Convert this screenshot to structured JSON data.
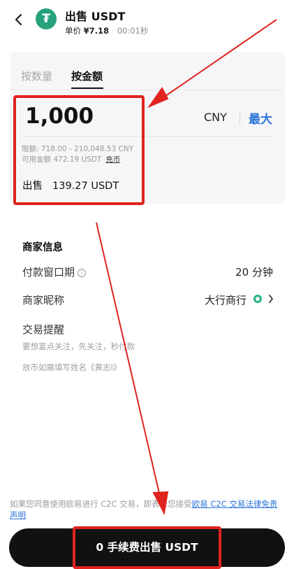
{
  "header": {
    "title": "出售 USDT",
    "unit_price_label": "单价",
    "unit_price": "¥7.18",
    "timer": "00:01秒",
    "coin_symbol": "₮"
  },
  "tabs": {
    "by_quantity": "按数量",
    "by_amount": "按金额"
  },
  "amount": {
    "value": "1,000",
    "currency": "CNY",
    "max_label": "最大",
    "limit": "限额: 718.00 - 210,048.53 CNY",
    "available": "可用金额 472.19 USDT",
    "recharge": "充币",
    "sell_label": "出售",
    "sell_value": "139.27 USDT"
  },
  "merchant": {
    "section_title": "商家信息",
    "payment_window_label": "付款窗口期",
    "payment_window_value": "20 分钟",
    "nickname_label": "商家昵称",
    "nickname_value": "大行商行",
    "trade_notice_label": "交易提醒",
    "notice_line1": "要想富点关注，先关注，秒付款",
    "notice_line2": "放币如需填写姓名《黄志Ⅰ》"
  },
  "footer": {
    "agreement_prefix": "如果您同意使用欧易进行 C2C 交易，即表示您接受",
    "agreement_link": "欧易 C2C 交易法律免责声明",
    "cta": "0 手续费出售 USDT"
  },
  "colors": {
    "accent_blue": "#2b74d8",
    "highlight_red": "#e0231f",
    "tether_green": "#26a17b",
    "cta_black": "#111111"
  },
  "icons": {
    "back": "chevron-left-icon",
    "info": "info-icon",
    "verified": "verified-badge-icon",
    "detail": "chevron-right-icon"
  }
}
